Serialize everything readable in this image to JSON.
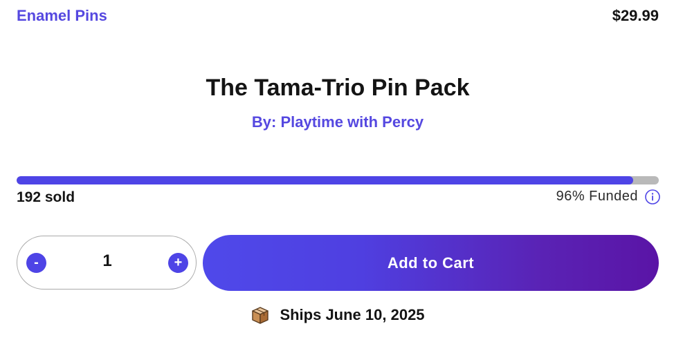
{
  "header": {
    "category": "Enamel Pins",
    "price": "$29.99"
  },
  "product": {
    "title": "The Tama-Trio Pin Pack",
    "creator": "By: Playtime with Percy"
  },
  "progress": {
    "fraction": 0.96,
    "sold_text": "192 sold",
    "funded_text": "96% Funded",
    "info_icon": "info-icon"
  },
  "quantity": {
    "minus_label": "-",
    "value": "1",
    "plus_label": "+"
  },
  "cart": {
    "button_label": "Add to Cart"
  },
  "shipping": {
    "icon": "box-icon",
    "text": "Ships June 10, 2025"
  },
  "colors": {
    "accent": "#4e44e6",
    "track": "#b9b9b9",
    "gradient_end": "#5a14a6"
  }
}
